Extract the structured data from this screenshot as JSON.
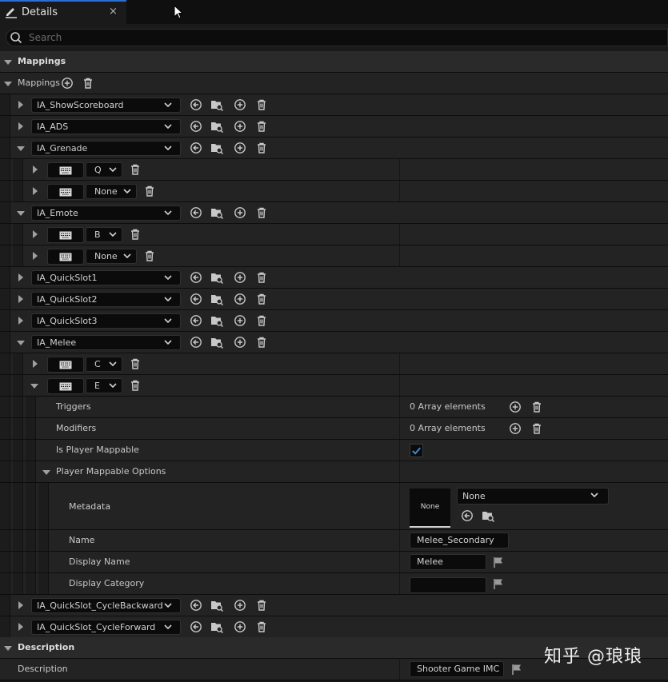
{
  "tab": {
    "title": "Details",
    "close": "×"
  },
  "search": {
    "placeholder": "Search"
  },
  "categories": {
    "mappings": "Mappings",
    "description": "Description"
  },
  "mappings_label": "Mappings",
  "actions": [
    {
      "name": "IA_ShowScoreboard"
    },
    {
      "name": "IA_ADS"
    },
    {
      "name": "IA_Grenade",
      "keys": [
        "Q",
        "None"
      ]
    },
    {
      "name": "IA_Emote",
      "keys": [
        "B",
        "None"
      ]
    },
    {
      "name": "IA_QuickSlot1"
    },
    {
      "name": "IA_QuickSlot2"
    },
    {
      "name": "IA_QuickSlot3"
    },
    {
      "name": "IA_Melee",
      "keys": [
        "C",
        "E"
      ]
    },
    {
      "name": "IA_QuickSlot_CycleBackward"
    },
    {
      "name": "IA_QuickSlot_CycleForward"
    }
  ],
  "details": {
    "triggers_label": "Triggers",
    "triggers_value": "0 Array elements",
    "modifiers_label": "Modifiers",
    "modifiers_value": "0 Array elements",
    "is_player_mappable_label": "Is Player Mappable",
    "is_player_mappable": true,
    "player_mappable_options_label": "Player Mappable Options",
    "metadata_label": "Metadata",
    "metadata_thumb": "None",
    "metadata_value": "None",
    "name_label": "Name",
    "name_value": "Melee_Secondary",
    "display_name_label": "Display Name",
    "display_name_value": "Melee",
    "display_category_label": "Display Category",
    "display_category_value": ""
  },
  "description": {
    "label": "Description",
    "value": "Shooter Game IMC"
  },
  "watermark": "知乎 @琅琅",
  "colors": {
    "accent": "#2a6fd6",
    "background": "#151515",
    "row": "#232323",
    "category": "#2a2a2a"
  }
}
